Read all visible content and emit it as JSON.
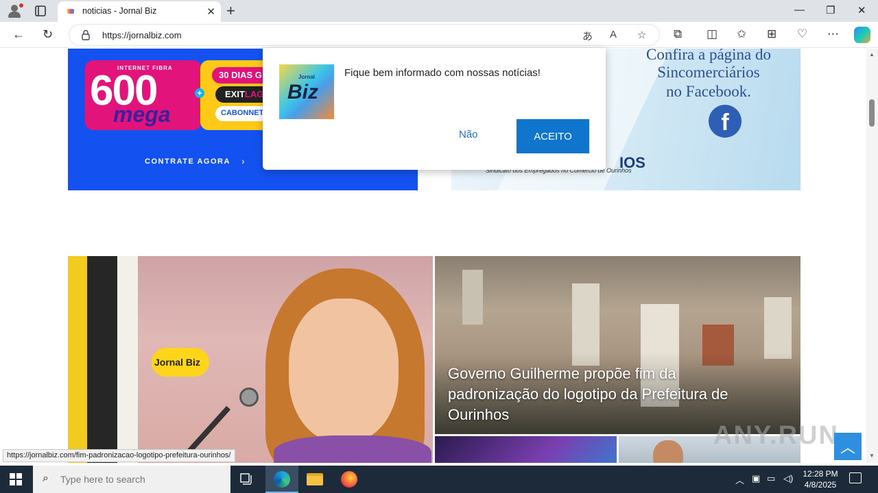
{
  "browser": {
    "tab_title": "noticias - Jornal Biz",
    "new_tab_symbol": "+",
    "url": "https://jornalbiz.com",
    "status_url": "https://jornalbiz.com/fim-padronizacao-logotipo-prefeitura-ourinhos/",
    "icons": [
      "profile-icon",
      "tab-actions-icon",
      "close-icon",
      "back-icon",
      "refresh-icon",
      "lock-icon",
      "translate-icon",
      "read-aloud-icon",
      "favorite-star-icon",
      "extensions-icon",
      "split-screen-icon",
      "favorites-icon",
      "collections-icon",
      "browser-essentials-icon",
      "more-icon",
      "copilot-icon"
    ]
  },
  "ads": {
    "internet": {
      "badge": "INTERNET FIBRA",
      "speed": "600",
      "unit": "mega",
      "promo": "30 DIAS G",
      "partner1_a": "EXIT",
      "partner1_b": "LAG",
      "partner2": "CABONNET F",
      "cta": "CONTRATE AGORA"
    },
    "sincomerciarios": {
      "line1": "Confira a página do",
      "line2": "Sincomerciários",
      "line3": "no Facebook.",
      "fb_letter": "f",
      "org_fragment": "IOS",
      "org_sub": "Sindicato dos Empregados no Comércio de Ourinhos"
    }
  },
  "popup": {
    "logo_small": "Jornal",
    "logo_big": "Biz",
    "message": "Fique bem informado com nossas notícias!",
    "decline": "Não",
    "accept": "ACEITO"
  },
  "articles": {
    "left_logo": "Jornal Biz",
    "headline": "Governo Guilherme propõe fim da padronização do logotipo da Prefeitura de Ourinhos"
  },
  "watermark": "ANY.RUN",
  "taskbar": {
    "search_placeholder": "Type here to search",
    "time": "12:28 PM",
    "date": "4/8/2025"
  },
  "theme": {
    "accent": "#0f75cd",
    "ad_blue": "#1352f0",
    "ad_pink": "#e3137c",
    "ad_yellow": "#ffc918",
    "taskbar": "#1c2a3a"
  }
}
